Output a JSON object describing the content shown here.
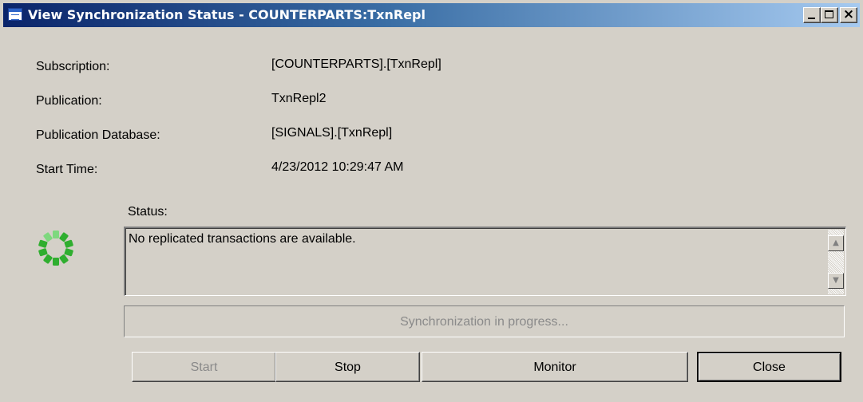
{
  "window": {
    "title": "View Synchronization Status - COUNTERPARTS:TxnRepl",
    "icon": "window-icon",
    "controls": [
      "minimize",
      "maximize",
      "close"
    ]
  },
  "details": {
    "subscription_label": "Subscription:",
    "subscription_value": "[COUNTERPARTS].[TxnRepl]",
    "publication_label": "Publication:",
    "publication_value": "TxnRepl2",
    "publication_db_label": "Publication Database:",
    "publication_db_value": "[SIGNALS].[TxnRepl]",
    "start_time_label": "Start Time:",
    "start_time_value": "4/23/2012 10:29:47 AM"
  },
  "status": {
    "label": "Status:",
    "message": "No replicated transactions are available.",
    "spinner_icon": "busy-spinner-icon",
    "spinner_colors": [
      "#2fae2f",
      "#7ed87e"
    ]
  },
  "progress": {
    "text": "Synchronization in progress..."
  },
  "buttons": {
    "start": "Start",
    "stop": "Stop",
    "monitor": "Monitor",
    "close": "Close"
  },
  "colors": {
    "titlebar_start": "#0a246a",
    "titlebar_end": "#a6caf0",
    "face": "#d4d0c8",
    "disabled_text": "#8a8a8a"
  }
}
